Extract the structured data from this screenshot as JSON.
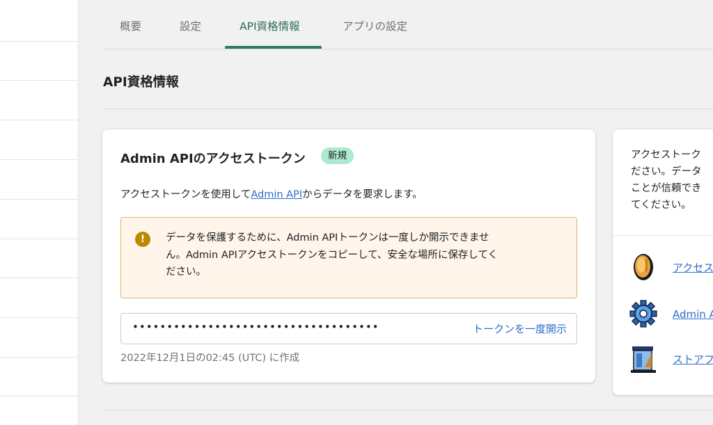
{
  "tabs": [
    {
      "label": "概要"
    },
    {
      "label": "設定"
    },
    {
      "label": "API資格情報"
    },
    {
      "label": "アプリの設定"
    }
  ],
  "section": {
    "title": "API資格情報"
  },
  "admin_card": {
    "title": "Admin APIのアクセストークン",
    "badge": "新規",
    "desc_prefix": "アクセストークンを使用して",
    "desc_link": "Admin API",
    "desc_suffix": "からデータを要求します。",
    "banner": {
      "line1": "データを保護するために、Admin APIトークンは一度しか開示できませ",
      "line2": "ん。Admin APIアクセストークンをコピーして、安全な場所に保存してく",
      "line3": "ださい。",
      "icon": "!"
    },
    "token": {
      "masked": "••••••••••••••••••••••••••••••••••••",
      "reveal_label": "トークンを一度開示"
    },
    "created": "2022年12月1日の02:45 (UTC) に作成"
  },
  "side_card": {
    "text_lines": [
      "アクセストーク",
      "ださい。データ",
      "ことが信頼でき",
      "てください。"
    ],
    "resources": [
      {
        "label": "アクセス",
        "icon": "coin-icon"
      },
      {
        "label": "Admin A",
        "icon": "gear-icon"
      },
      {
        "label": "ストアフ",
        "icon": "storefront-icon"
      }
    ]
  },
  "colors": {
    "accent": "#2a7a66",
    "link": "#2c6ecb",
    "warning_bg": "#fff5ea",
    "warning_border": "#e0b36a",
    "badge_bg": "#aee9d1"
  }
}
